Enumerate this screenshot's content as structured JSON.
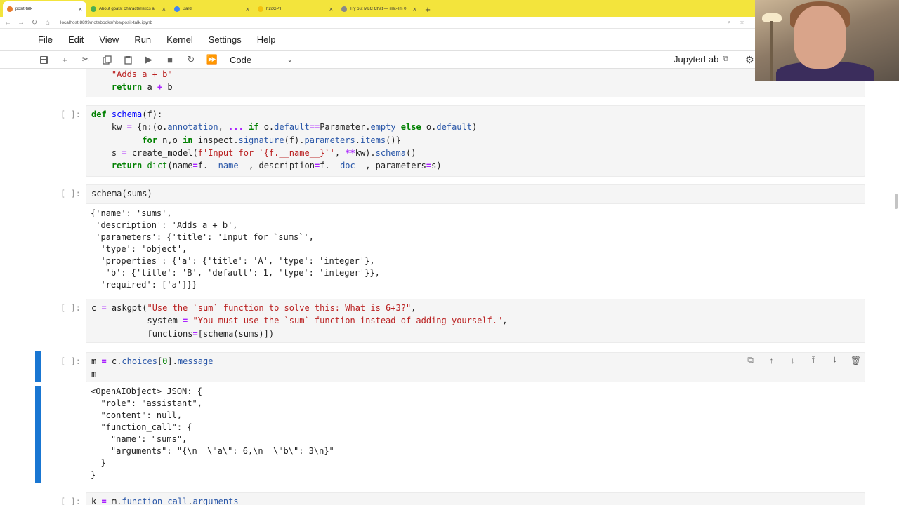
{
  "browser": {
    "tabs": [
      {
        "title": "posit-talk",
        "active": true
      },
      {
        "title": "About goats: characteristics a"
      },
      {
        "title": "Bard"
      },
      {
        "title": "h2oGPT"
      },
      {
        "title": "Try out MLC Chat — mlc-llm 0"
      }
    ],
    "url": "localhost:8899/notebooks/nbs/posit-talk.ipynb"
  },
  "menu": [
    "File",
    "Edit",
    "View",
    "Run",
    "Kernel",
    "Settings",
    "Help"
  ],
  "toolbar": {
    "cell_type": "Code",
    "brand": "JupyterLab"
  },
  "cells": {
    "c0": {
      "lines": [
        "    \"Adds a + b\"",
        "    return a + b"
      ]
    },
    "c1": {
      "prompt": "[ ]:"
    },
    "c2": {
      "prompt": "[ ]:",
      "code": "schema(sums)"
    },
    "c2_output": [
      "{'name': 'sums',",
      " 'description': 'Adds a + b',",
      " 'parameters': {'title': 'Input for `sums`',",
      "  'type': 'object',",
      "  'properties': {'a': {'title': 'A', 'type': 'integer'},",
      "   'b': {'title': 'B', 'default': 1, 'type': 'integer'}},",
      "  'required': ['a']}}"
    ],
    "c3": {
      "prompt": "[ ]:"
    },
    "c4": {
      "prompt": "[ ]:"
    },
    "c4_output": [
      "<OpenAIObject> JSON: {",
      "  \"role\": \"assistant\",",
      "  \"content\": null,",
      "  \"function_call\": {",
      "    \"name\": \"sums\",",
      "    \"arguments\": \"{\\n  \\\"a\\\": 6,\\n  \\\"b\\\": 3\\n}\"",
      "  }",
      "}"
    ],
    "c5": {
      "prompt": "[ ]:",
      "code": "k = m.function_call.arguments"
    }
  }
}
